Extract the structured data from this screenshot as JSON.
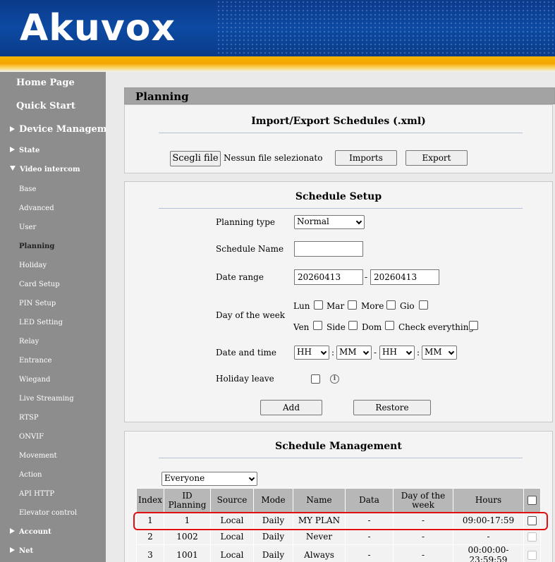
{
  "header": {
    "logo_text": "Akuvox"
  },
  "sidebar": {
    "home": "Home Page",
    "quick_start": "Quick Start",
    "device_management": "Device Management",
    "state": "State",
    "video_intercom": "Video intercom",
    "subitems": [
      "Base",
      "Advanced",
      "User",
      "Planning",
      "Holiday",
      "Card Setup",
      "PIN Setup",
      "LED Setting",
      "Relay",
      "Entrance",
      "Wiegand",
      "Live Streaming",
      "RTSP",
      "ONVIF",
      "Movement",
      "Action",
      "API HTTP",
      "Elevator control"
    ],
    "active": "Planning",
    "account": "Account",
    "net": "Net"
  },
  "page_title": "Planning",
  "import_export": {
    "title": "Import/Export Schedules (.xml)",
    "choose_file": "Scegli file",
    "no_file": "Nessun file selezionato",
    "imports": "Imports",
    "export": "Export"
  },
  "schedule_setup": {
    "title": "Schedule Setup",
    "planning_type_label": "Planning type",
    "planning_type_value": "Normal",
    "schedule_name_label": "Schedule Name",
    "schedule_name_value": "",
    "date_range_label": "Date range",
    "date_from": "20260413",
    "date_sep": "-",
    "date_to": "20260413",
    "day_of_week_label": "Day of the week",
    "days": [
      "Lun",
      "Mar",
      "More",
      "Gio",
      "Ven",
      "Side",
      "Dom",
      "Check everything"
    ],
    "date_time_label": "Date and time",
    "time_selects": [
      "HH",
      "MM",
      "HH",
      "MM"
    ],
    "colon": ":",
    "dash": "-",
    "holiday_leave_label": "Holiday leave",
    "info_symbol": "i",
    "add": "Add",
    "restore": "Restore"
  },
  "schedule_management": {
    "title": "Schedule Management",
    "filter_value": "Everyone",
    "columns": [
      "Index",
      "ID Planning",
      "Source",
      "Mode",
      "Name",
      "Data",
      "Day of the week",
      "Hours"
    ],
    "rows": [
      [
        "1",
        "1",
        "Local",
        "Daily",
        "MY PLAN",
        "-",
        "-",
        "09:00-17:59"
      ],
      [
        "2",
        "1002",
        "Local",
        "Daily",
        "Never",
        "-",
        "-",
        "-"
      ],
      [
        "3",
        "1001",
        "Local",
        "Daily",
        "Always",
        "-",
        "-",
        "00:00:00-23:59:59"
      ]
    ]
  },
  "colors": {
    "header_blue": "#0d4aa3",
    "accent_gold": "#f3a400",
    "sidebar_gray": "#8d8d8d",
    "highlight_red": "#e01010"
  }
}
